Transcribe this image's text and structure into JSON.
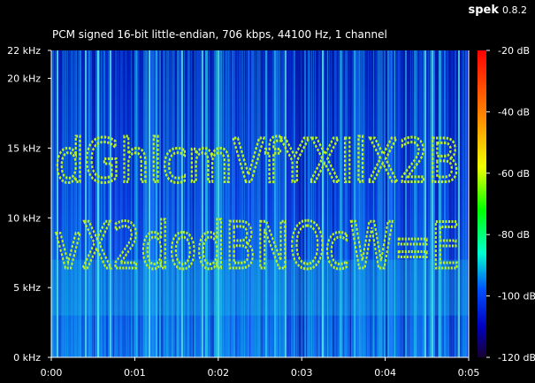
{
  "app": {
    "name": "spek",
    "version": "0.8.2"
  },
  "file_info": "PCM signed 16-bit little-endian, 706 kbps, 44100 Hz, 1 channel",
  "colors": {
    "background": "#000000",
    "text": "#ffffff",
    "spectrum_base": "#0a30d8",
    "letter_glyph": "#b8f020"
  },
  "chart_data": {
    "type": "heatmap",
    "title": "PCM signed 16-bit little-endian, 706 kbps, 44100 Hz, 1 channel",
    "xlabel": "",
    "ylabel": "",
    "x": {
      "unit": "s",
      "range": [
        0,
        0.05
      ],
      "ticks": [
        "0:00",
        "0:01",
        "0:02",
        "0:03",
        "0:04",
        "0:05"
      ]
    },
    "y": {
      "unit": "kHz",
      "range": [
        0,
        22
      ],
      "ticks": [
        {
          "value": 0,
          "label": "0 kHz"
        },
        {
          "value": 5,
          "label": "5 kHz"
        },
        {
          "value": 10,
          "label": "10 kHz"
        },
        {
          "value": 15,
          "label": "15 kHz"
        },
        {
          "value": 20,
          "label": "20 kHz"
        },
        {
          "value": 22,
          "label": "22 kHz"
        }
      ]
    },
    "colorbar": {
      "unit": "dB",
      "range": [
        -120,
        -20
      ],
      "ticks": [
        {
          "value": -20,
          "label": "-20 dB"
        },
        {
          "value": -40,
          "label": "-40 dB"
        },
        {
          "value": -60,
          "label": "-60 dB"
        },
        {
          "value": -80,
          "label": "-80 dB"
        },
        {
          "value": -100,
          "label": "-100 dB"
        },
        {
          "value": -120,
          "label": "-120 dB"
        }
      ]
    },
    "hidden_text_lines": [
      {
        "text": "dGhlcmVfYXIlX2B",
        "freq_range_khz": [
          12.6,
          16.2
        ]
      },
      {
        "text": "vX2dodBNOcW=E",
        "freq_range_khz": [
          6.4,
          10.2
        ]
      }
    ]
  }
}
